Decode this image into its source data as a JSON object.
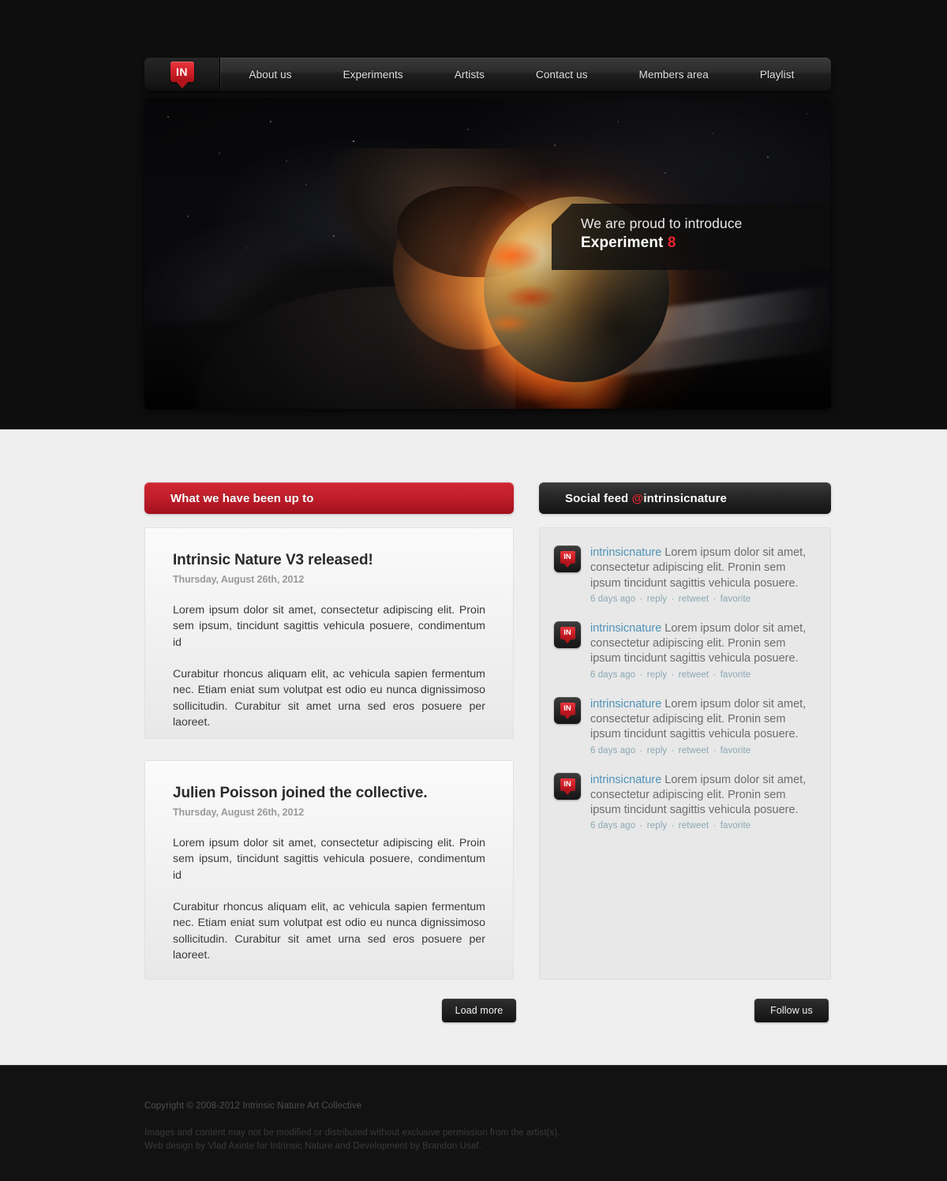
{
  "site": {
    "logo_text": "IN",
    "logo_icon": "in-badge-icon"
  },
  "nav": {
    "items": [
      {
        "label": "About us"
      },
      {
        "label": "Experiments"
      },
      {
        "label": "Artists"
      },
      {
        "label": "Contact us"
      },
      {
        "label": "Members area"
      },
      {
        "label": "Playlist"
      }
    ]
  },
  "hero": {
    "caption_line1": "We are proud to introduce",
    "caption_title": "Experiment",
    "caption_number": "8",
    "image_alt": "man exhaling fire onto a burning earth in space"
  },
  "news": {
    "header": "What we have been up to",
    "articles": [
      {
        "title": "Intrinsic Nature V3 released!",
        "date": "Thursday, August 26th, 2012",
        "para1": "Lorem ipsum dolor sit amet, consectetur adipiscing elit. Proin sem ipsum, tincidunt sagittis vehicula posuere, condimentum id",
        "para2": "Curabitur rhoncus aliquam elit, ac vehicula sapien fermentum nec. Etiam eniat sum volutpat est odio eu nunca dignissimoso sollicitudin. Curabitur sit amet urna sed eros posuere per laoreet."
      },
      {
        "title": "Julien Poisson joined the collective.",
        "date": "Thursday, August 26th, 2012",
        "para1": "Lorem ipsum dolor sit amet, consectetur adipiscing elit. Proin sem ipsum, tincidunt sagittis vehicula posuere, condimentum id",
        "para2": "Curabitur rhoncus aliquam elit, ac vehicula sapien fermentum nec. Etiam eniat sum volutpat est odio eu nunca dignissimoso sollicitudin. Curabitur sit amet urna sed eros posuere per laoreet."
      }
    ],
    "load_more_label": "Load more"
  },
  "social": {
    "header_prefix": "Social feed ",
    "header_at": "@",
    "header_handle": "intrinsicnature",
    "follow_label": "Follow us",
    "avatar_text": "IN",
    "tweets": [
      {
        "user": "intrinsicnature",
        "text": " Lorem ipsum dolor sit amet, consectetur adipiscing elit. Pronin sem ipsum tincidunt sagittis vehicula posuere.",
        "time": "6 days ago",
        "reply": "reply",
        "retweet": "retweet",
        "favorite": "favorite"
      },
      {
        "user": "intrinsicnature",
        "text": " Lorem ipsum dolor sit amet, consectetur adipiscing elit. Pronin sem ipsum tincidunt sagittis vehicula posuere.",
        "time": "6 days ago",
        "reply": "reply",
        "retweet": "retweet",
        "favorite": "favorite"
      },
      {
        "user": "intrinsicnature",
        "text": " Lorem ipsum dolor sit amet, consectetur adipiscing elit. Pronin sem ipsum tincidunt sagittis vehicula posuere.",
        "time": "6 days ago",
        "reply": "reply",
        "retweet": "retweet",
        "favorite": "favorite"
      },
      {
        "user": "intrinsicnature",
        "text": " Lorem ipsum dolor sit amet, consectetur adipiscing elit. Pronin sem ipsum tincidunt sagittis vehicula posuere.",
        "time": "6 days ago",
        "reply": "reply",
        "retweet": "retweet",
        "favorite": "favorite"
      }
    ]
  },
  "footer": {
    "copyright": "Copyright © 2008-2012  Intrinsic Nature Art Collective",
    "legal_line1": "Images and content may not be modified or distributed without exclusive permission from the artist(s).",
    "legal_line2": "Web design by Vlad Axinte for Intrinsic Nature and Development by Brandon Usaf."
  },
  "colors": {
    "accent_red": "#c11f2b",
    "dark_bg": "#0e0e0e",
    "body_bg": "#efefef",
    "link_blue": "#4f93b8",
    "meta_blue": "#8aa7b4"
  }
}
